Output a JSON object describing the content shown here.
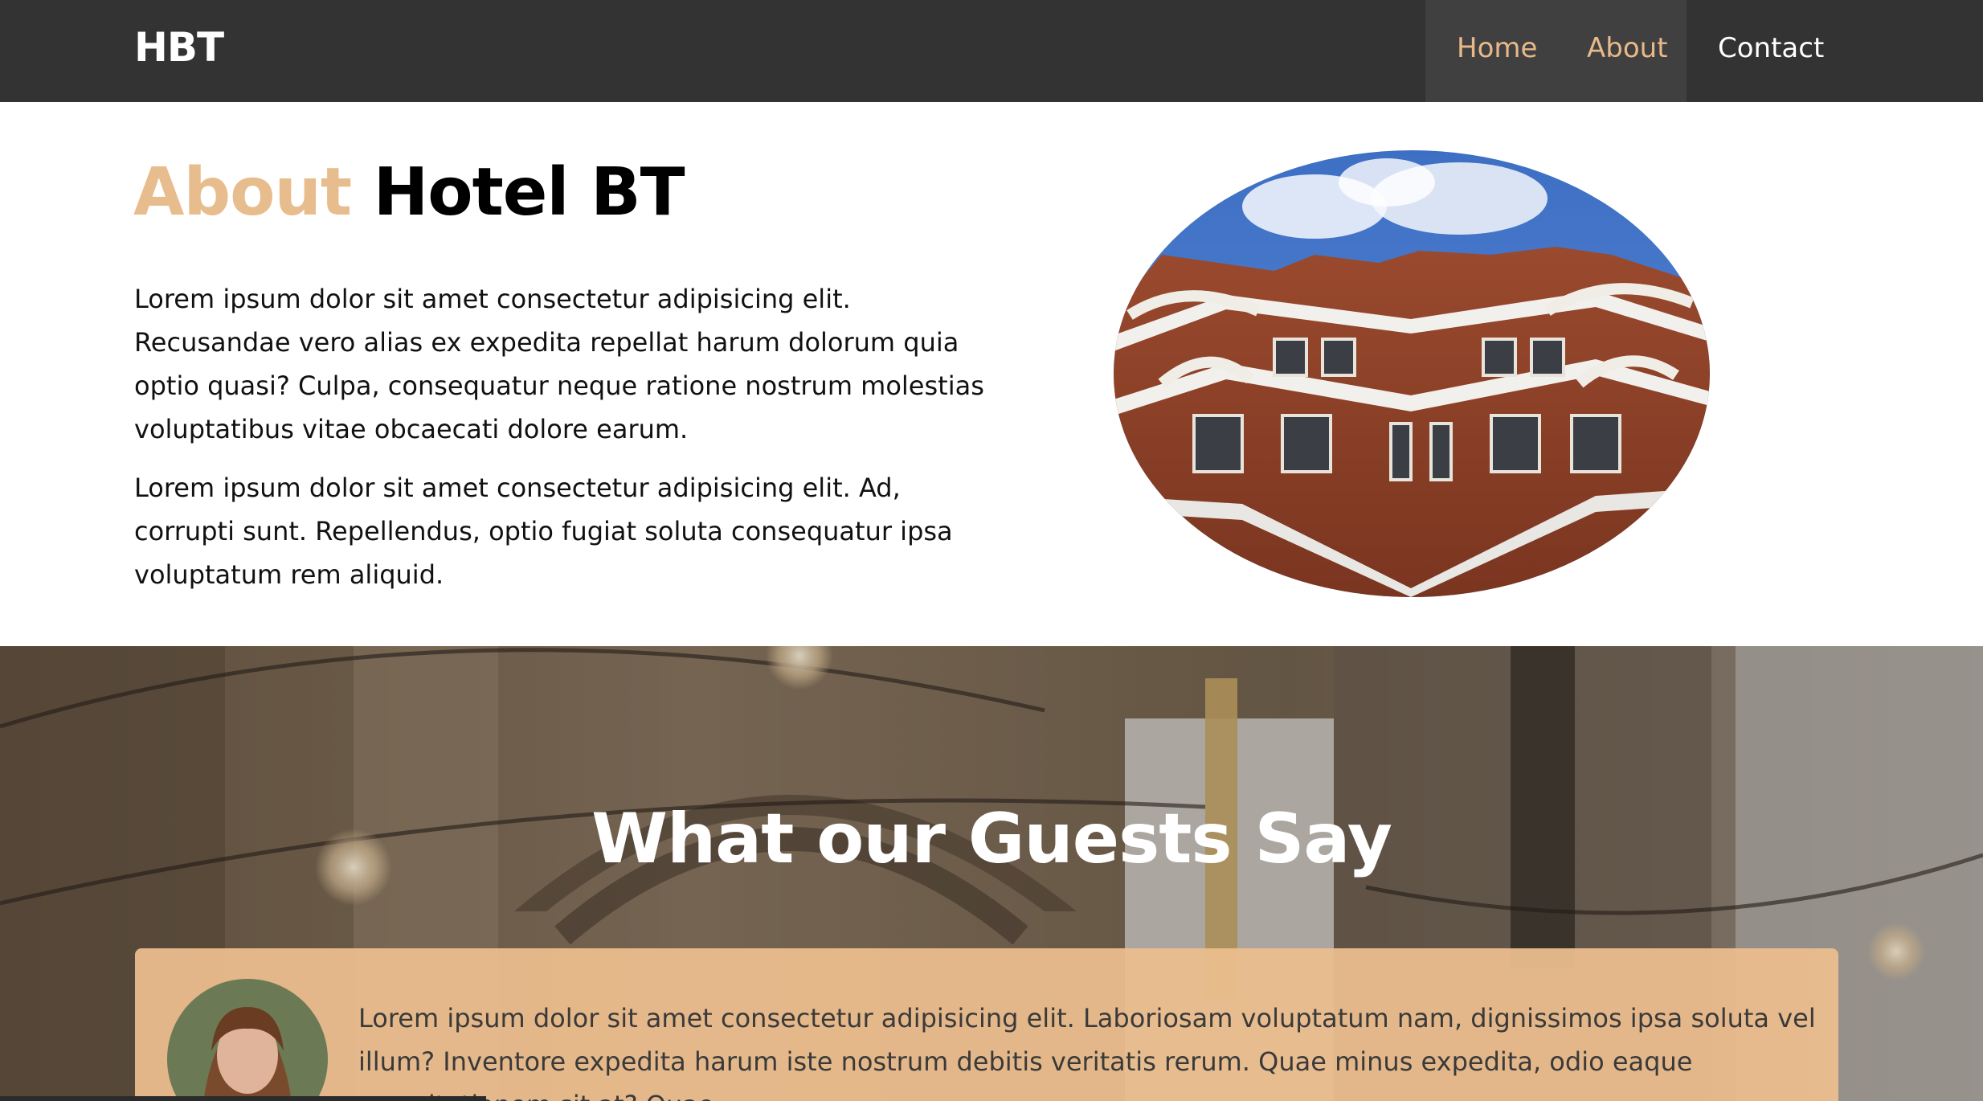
{
  "navbar": {
    "brand": "HBT",
    "links": [
      {
        "label": "Home",
        "active": true
      },
      {
        "label": "About",
        "active": true
      },
      {
        "label": "Contact",
        "active": false
      }
    ]
  },
  "about": {
    "title_accent": "About",
    "title_rest": "Hotel BT",
    "paragraphs": [
      "Lorem ipsum dolor sit amet consectetur adipisicing elit. Recusandae vero alias ex expedita repellat harum dolorum quia optio quasi? Culpa, consequatur neque ratione nostrum molestias voluptatibus vitae obcaecati dolore earum.",
      "Lorem ipsum dolor sit amet consectetur adipisicing elit. Ad, corrupti sunt. Repellendus, optio fugiat soluta consequatur ipsa voluptatum rem aliquid."
    ]
  },
  "testimonials": {
    "title": "What our Guests Say",
    "items": [
      {
        "text": "Lorem ipsum dolor sit amet consectetur adipisicing elit. Laboriosam voluptatum nam, dignissimos ipsa soluta vel illum? Inventore expedita harum iste nostrum debitis veritatis rerum. Quae minus expedita, odio eaque exercitationem sit at? Quae"
      }
    ]
  },
  "colors": {
    "navbar_bg": "#333333",
    "accent": "#e8bd8d",
    "card_bg": "#ebbd8d"
  }
}
